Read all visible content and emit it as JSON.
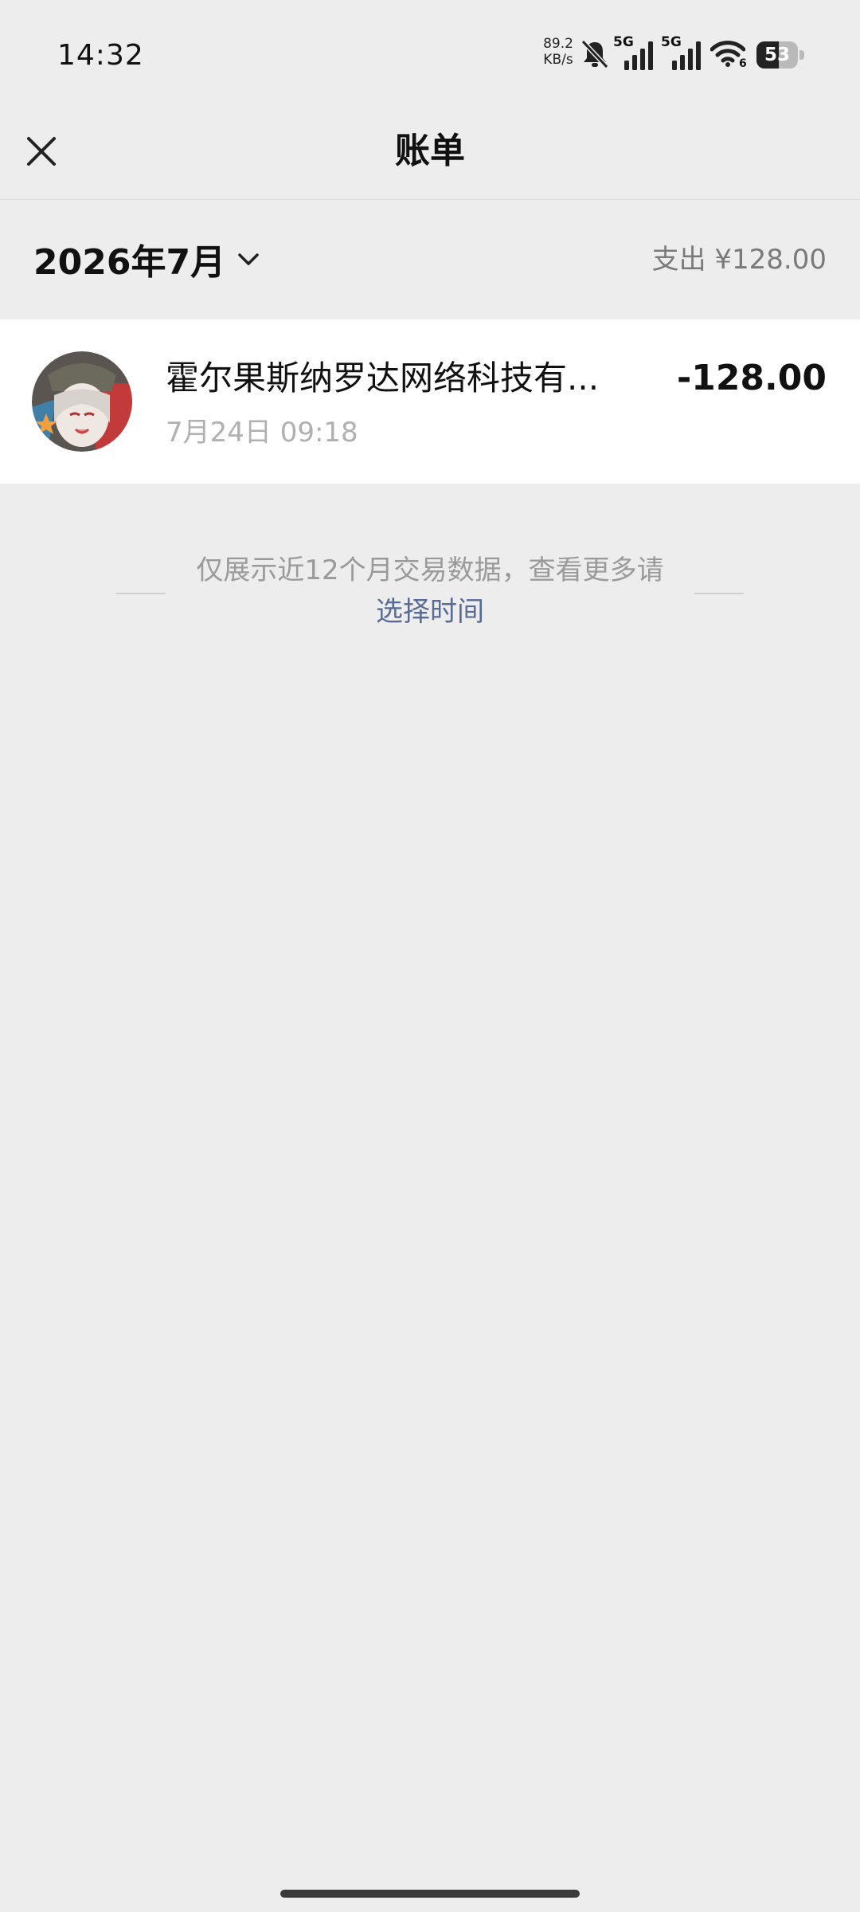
{
  "status_bar": {
    "time": "14:32",
    "net_speed_value": "89.2",
    "net_speed_unit": "KB/s",
    "signal_1_label": "5G",
    "signal_2_label": "5G",
    "wifi_label": "6",
    "battery_level": "53",
    "battery_percent": 53,
    "icons": [
      "bell-muted-icon",
      "signal-icon",
      "signal-icon",
      "wifi-icon",
      "battery-icon"
    ]
  },
  "nav": {
    "title": "账单",
    "close_icon": "close-icon"
  },
  "month_header": {
    "month_label": "2026年7月",
    "chevron_icon": "chevron-down-icon",
    "expense_summary": "支出 ¥128.00"
  },
  "transactions": [
    {
      "merchant": "霍尔果斯纳罗达网络科技有...",
      "time": "7月24日 09:18",
      "amount": "-128.00",
      "avatar_icon": "merchant-avatar"
    }
  ],
  "notice": {
    "text": "仅展示近12个月交易数据，查看更多请",
    "link": "选择时间"
  },
  "colors": {
    "background": "#ededed",
    "card": "#ffffff",
    "link": "#576b95",
    "secondary_text": "#b0b0b0"
  }
}
